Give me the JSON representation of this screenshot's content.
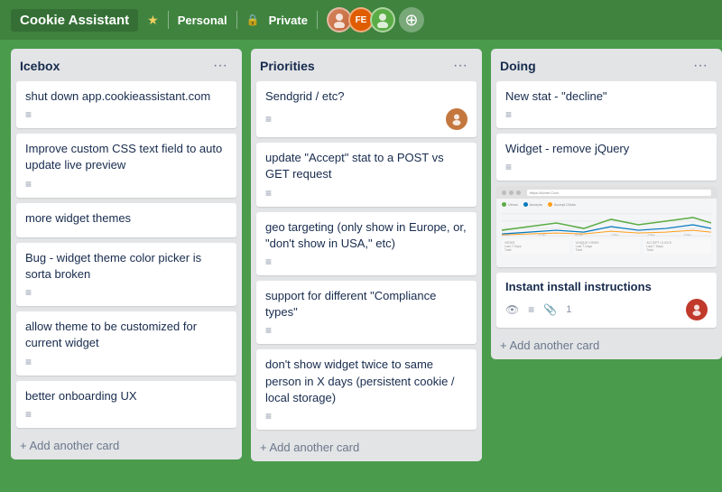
{
  "header": {
    "title": "Cookie Assistant",
    "workspace": "Personal",
    "privacy": "Private",
    "star_icon": "★",
    "lock_icon": "🔒",
    "avatars": [
      {
        "initials": "",
        "color": "#e07b4f",
        "is_photo": true,
        "bg": "#c4733e"
      },
      {
        "initials": "FE",
        "color": "#e05c00",
        "bg": "#e05c00"
      },
      {
        "initials": "",
        "color": "#5aac44",
        "is_photo": true,
        "bg": "#5aac44"
      }
    ],
    "add_member_icon": "+"
  },
  "columns": [
    {
      "id": "icebox",
      "title": "Icebox",
      "menu_label": "···",
      "cards": [
        {
          "id": "c1",
          "title": "shut down app.cookieassistant.com",
          "has_description": true,
          "avatar": null
        },
        {
          "id": "c2",
          "title": "Improve custom CSS text field to auto update live preview",
          "has_description": true,
          "avatar": null
        },
        {
          "id": "c3",
          "title": "more widget themes",
          "has_description": false,
          "avatar": null
        },
        {
          "id": "c4",
          "title": "Bug - widget theme color picker is sorta broken",
          "has_description": true,
          "avatar": null
        },
        {
          "id": "c5",
          "title": "allow theme to be customized for current widget",
          "has_description": true,
          "avatar": null
        },
        {
          "id": "c6",
          "title": "better onboarding UX",
          "has_description": true,
          "avatar": null
        }
      ],
      "add_label": "+ Add another card"
    },
    {
      "id": "priorities",
      "title": "Priorities",
      "menu_label": "···",
      "cards": [
        {
          "id": "p1",
          "title": "Sendgrid / etc?",
          "has_description": true,
          "avatar": {
            "color": "#c4773e",
            "initials": ""
          }
        },
        {
          "id": "p2",
          "title": "update \"Accept\" stat to a POST vs GET request",
          "has_description": true,
          "avatar": null
        },
        {
          "id": "p3",
          "title": "geo targeting (only show in Europe, or, \"don't show in USA,\" etc)",
          "has_description": true,
          "avatar": null
        },
        {
          "id": "p4",
          "title": "support for different \"Compliance types\"",
          "has_description": true,
          "avatar": null
        },
        {
          "id": "p5",
          "title": "don't show widget twice to same person in X days (persistent cookie / local storage)",
          "has_description": true,
          "avatar": null
        }
      ],
      "add_label": "+ Add another card"
    },
    {
      "id": "doing",
      "title": "Doing",
      "menu_label": "···",
      "cards": [
        {
          "id": "d1",
          "title": "New stat - \"decline\"",
          "has_description": true,
          "avatar": null,
          "type": "normal"
        },
        {
          "id": "d2",
          "title": "Widget - remove jQuery",
          "has_description": true,
          "avatar": null,
          "type": "normal"
        },
        {
          "id": "d3",
          "title": "",
          "type": "widget_preview"
        },
        {
          "id": "d4",
          "title": "Instant install instructions",
          "type": "instant",
          "has_eye": true,
          "has_description": true,
          "attachment_count": "1",
          "avatar": {
            "color": "#c0392b",
            "initials": ""
          }
        }
      ],
      "add_label": "+ Add another card"
    }
  ],
  "mock_chart": {
    "url": "https://Acme.Com",
    "legend": [
      {
        "label": "Views",
        "color": "#5aac44"
      },
      {
        "label": "Accepts",
        "color": "#0079bf"
      },
      {
        "label": "Accept Clicks",
        "color": "#ff9f1a"
      }
    ],
    "stat_boxes": [
      {
        "label": "Last 7 Days",
        "sub": "Total",
        "value": "—"
      },
      {
        "label": "Last 7 Days",
        "sub": "Total",
        "value": "—"
      },
      {
        "label": "Last 7 Days",
        "sub": "Total",
        "value": "—"
      }
    ]
  }
}
